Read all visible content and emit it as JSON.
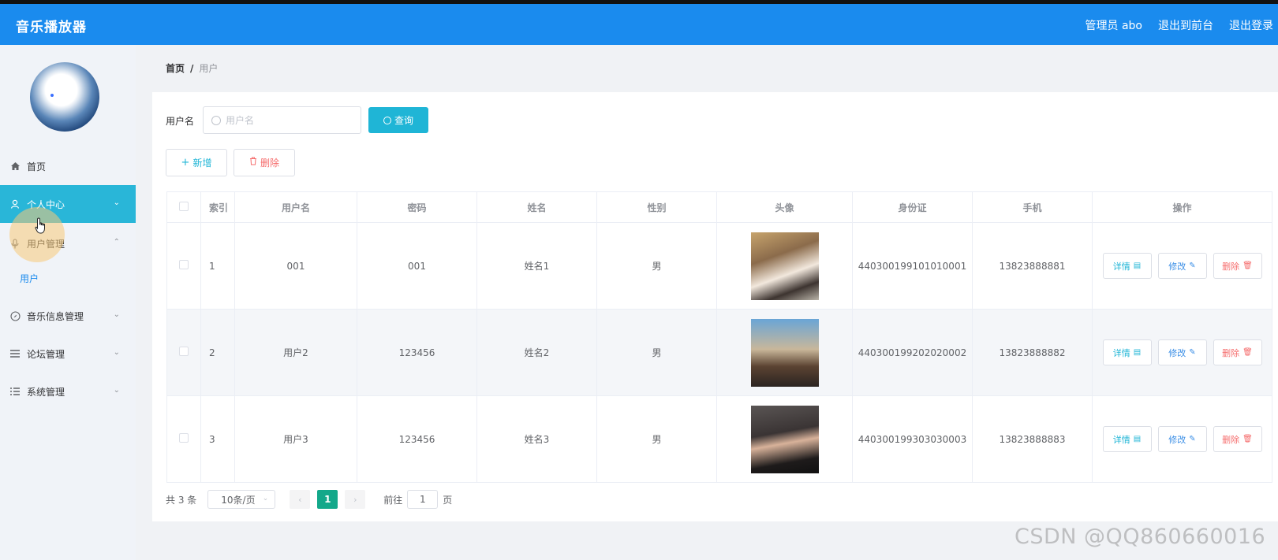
{
  "header": {
    "title": "音乐播放器",
    "admin": "管理员 abo",
    "back_front": "退出到前台",
    "logout": "退出登录"
  },
  "sidebar": {
    "items": [
      {
        "label": "首页",
        "icon": "home-icon"
      },
      {
        "label": "个人中心",
        "icon": "user-icon"
      },
      {
        "label": "用户管理",
        "icon": "microphone-icon"
      },
      {
        "label": "音乐信息管理",
        "icon": "compass-icon"
      },
      {
        "label": "论坛管理",
        "icon": "menu-lines-icon"
      },
      {
        "label": "系统管理",
        "icon": "list-icon"
      }
    ],
    "sub_item": "用户",
    "active_color": "#29b6d8"
  },
  "breadcrumb": {
    "home": "首页",
    "sep": "/",
    "current": "用户"
  },
  "search": {
    "label": "用户名",
    "placeholder": "用户名",
    "button": "查询"
  },
  "actions": {
    "add": "新增",
    "delete": "删除"
  },
  "table": {
    "headers": [
      "索引",
      "用户名",
      "密码",
      "姓名",
      "性别",
      "头像",
      "身份证",
      "手机",
      "操作"
    ],
    "rows": [
      {
        "index": "1",
        "username": "001",
        "password": "001",
        "name": "姓名1",
        "gender": "男",
        "idcard": "440300199101010001",
        "phone": "13823888881"
      },
      {
        "index": "2",
        "username": "用户2",
        "password": "123456",
        "name": "姓名2",
        "gender": "男",
        "idcard": "440300199202020002",
        "phone": "13823888882"
      },
      {
        "index": "3",
        "username": "用户3",
        "password": "123456",
        "name": "姓名3",
        "gender": "男",
        "idcard": "440300199303030003",
        "phone": "13823888883"
      }
    ],
    "op_detail": "详情",
    "op_edit": "修改",
    "op_delete": "删除"
  },
  "pagination": {
    "total": "共 3 条",
    "page_size": "10条/页",
    "current_page": "1",
    "goto_label": "前往",
    "goto_value": "1",
    "page_suffix": "页"
  },
  "watermark": "CSDN @QQ860660016",
  "colors": {
    "header": "#1a8bee",
    "primary": "#1fb5d6",
    "danger": "#f56c6c",
    "pager_active": "#13a88a"
  }
}
